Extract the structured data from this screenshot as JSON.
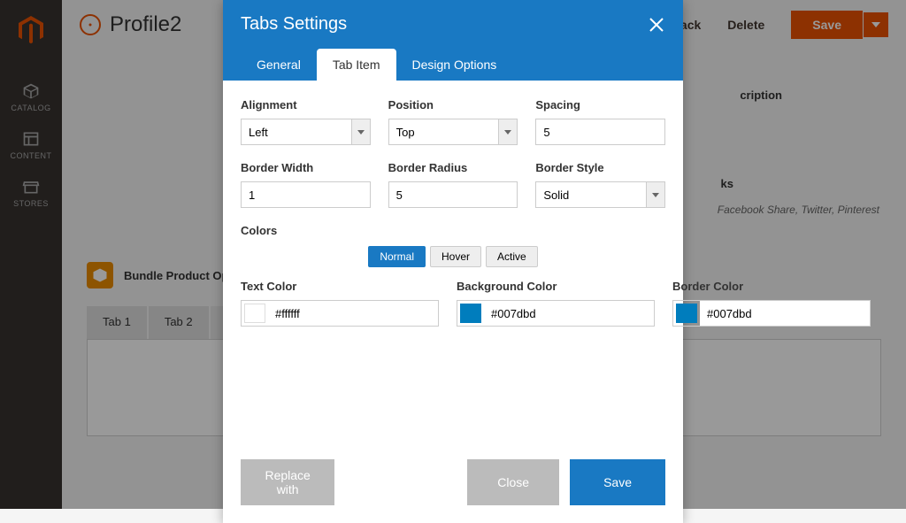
{
  "sidebar": {
    "items": [
      {
        "label": "CATALOG"
      },
      {
        "label": "CONTENT"
      },
      {
        "label": "STORES"
      }
    ]
  },
  "bg": {
    "title": "Profile2",
    "back": "Back",
    "delete": "Delete",
    "save": "Save",
    "right_text1": "cription",
    "right_text2": "ks",
    "right_text3": "Facebook Share, Twitter, Pinterest",
    "bundle": "Bundle Product Option",
    "tabs": [
      {
        "label": "Tab 1"
      },
      {
        "label": "Tab 2"
      }
    ]
  },
  "modal": {
    "title": "Tabs Settings",
    "tabs": [
      {
        "label": "General"
      },
      {
        "label": "Tab Item"
      },
      {
        "label": "Design Options"
      }
    ],
    "fields": {
      "alignment": {
        "label": "Alignment",
        "value": "Left"
      },
      "position": {
        "label": "Position",
        "value": "Top"
      },
      "spacing": {
        "label": "Spacing",
        "value": "5"
      },
      "border_width": {
        "label": "Border Width",
        "value": "1"
      },
      "border_radius": {
        "label": "Border Radius",
        "value": "5"
      },
      "border_style": {
        "label": "Border Style",
        "value": "Solid"
      }
    },
    "colors_section": "Colors",
    "state_tabs": [
      {
        "label": "Normal"
      },
      {
        "label": "Hover"
      },
      {
        "label": "Active"
      }
    ],
    "colors": {
      "text": {
        "label": "Text Color",
        "value": "#ffffff",
        "hex": "#ffffff"
      },
      "background": {
        "label": "Background Color",
        "value": "#007dbd",
        "hex": "#007dbd"
      },
      "border": {
        "label": "Border Color",
        "value": "#007dbd",
        "hex": "#007dbd"
      }
    },
    "footer": {
      "replace": "Replace with",
      "close": "Close",
      "save": "Save"
    }
  }
}
